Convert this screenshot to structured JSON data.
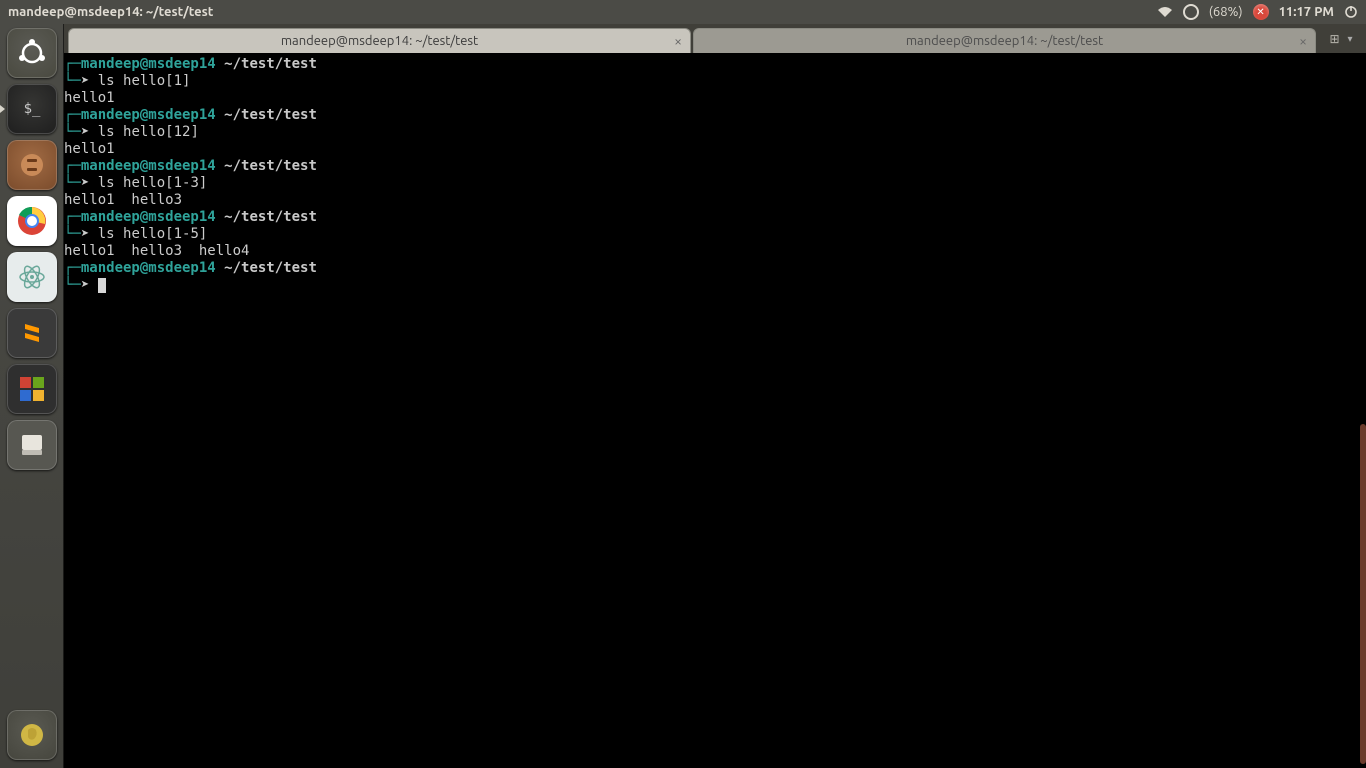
{
  "topbar": {
    "title": "mandeep@msdeep14: ~/test/test",
    "battery": "(68%)",
    "time": "11:17 PM"
  },
  "tabs": [
    {
      "title": "mandeep@msdeep14: ~/test/test",
      "active": true
    },
    {
      "title": "mandeep@msdeep14: ~/test/test",
      "active": false
    }
  ],
  "prompt": {
    "user": "mandeep@msdeep14",
    "path": "~/test/test",
    "arrow": "➤"
  },
  "session": [
    {
      "cmd": "ls hello[1]",
      "out": "hello1"
    },
    {
      "cmd": "ls hello[12]",
      "out": "hello1"
    },
    {
      "cmd": "ls hello[1-3]",
      "out": "hello1  hello3"
    },
    {
      "cmd": "ls hello[1-5]",
      "out": "hello1  hello3  hello4"
    }
  ],
  "launcher_icons": [
    "ubuntu",
    "terminal",
    "files",
    "chrome",
    "atom",
    "sublime",
    "windows",
    "disk",
    "trash"
  ]
}
